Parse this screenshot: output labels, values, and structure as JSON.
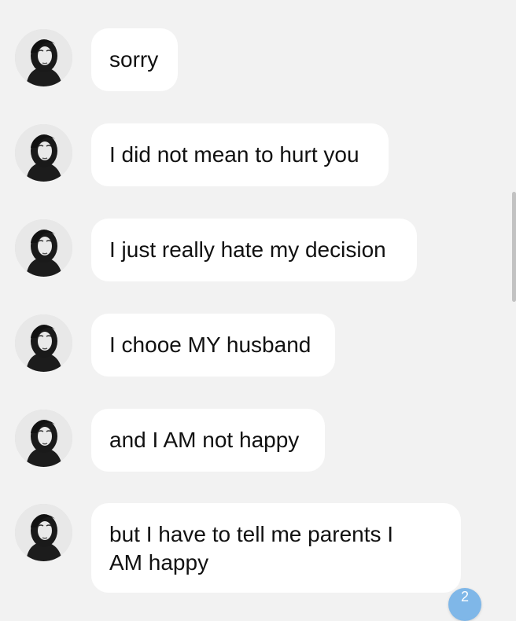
{
  "messages": [
    {
      "text": "sorry"
    },
    {
      "text": "I did not mean to hurt you"
    },
    {
      "text": "I just really hate my decision"
    },
    {
      "text": "I chooe MY husband"
    },
    {
      "text": "and I AM not happy"
    },
    {
      "text": "but I have to tell me parents I AM happy"
    }
  ],
  "unread_badge": "2",
  "colors": {
    "background": "#f2f2f2",
    "bubble": "#ffffff",
    "text": "#111111",
    "badge": "#7fb7e8"
  },
  "icons": {
    "avatar": "avatar-portrait-icon",
    "badge": "scroll-down-badge-icon"
  }
}
